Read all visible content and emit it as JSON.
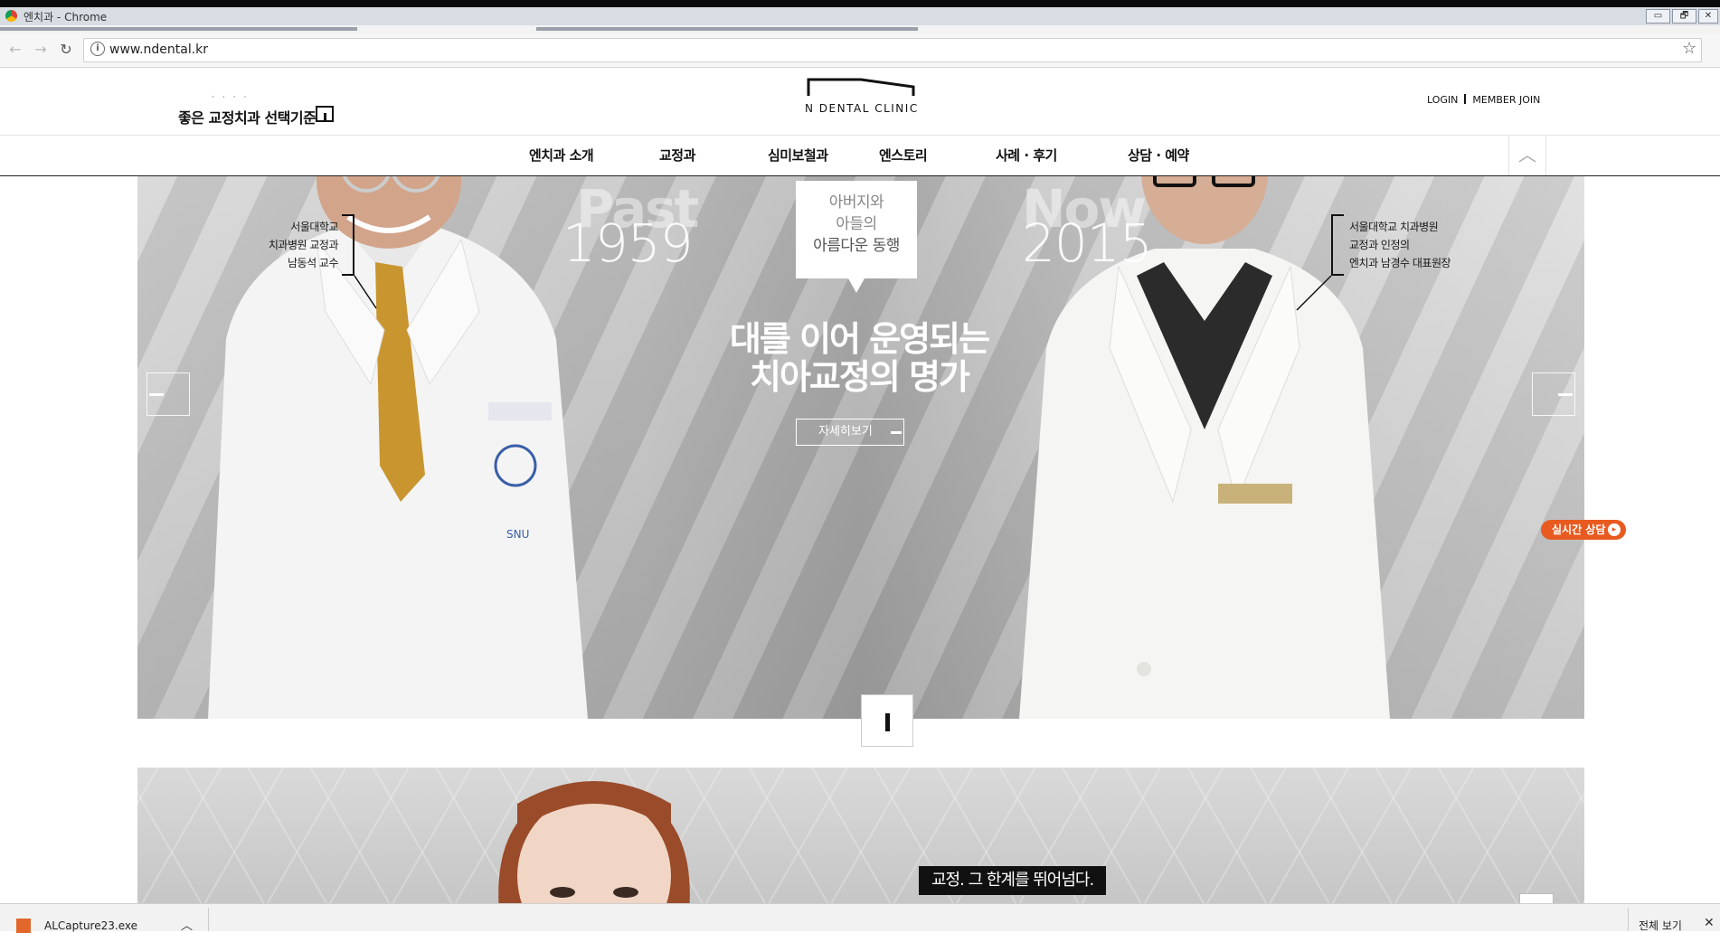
{
  "browser": {
    "window_title": "엔치과 - Chrome",
    "url": "www.ndental.kr",
    "win_buttons": [
      "▭",
      "🗗",
      "✕"
    ]
  },
  "header": {
    "slogan": "좋은 교정치과 선택기준",
    "logo_text": "N DENTAL CLINIC",
    "login": "LOGIN",
    "member_join": "MEMBER JOIN"
  },
  "gnb": {
    "items": [
      "엔치과 소개",
      "교정과",
      "심미보철과",
      "엔스토리",
      "사례 · 후기",
      "상담 · 예약"
    ]
  },
  "hero": {
    "past_word": "Past",
    "past_year": "1959",
    "now_word": "Now",
    "now_year": "2015",
    "left_caption": [
      "서울대학교",
      "치과병원 교정과",
      "남동석 교수"
    ],
    "right_caption": [
      "서울대학교 치과병원",
      "교정과 인정의",
      "엔치과 남경수 대표원장"
    ],
    "quote": [
      "아버지와",
      "아들의",
      "아름다운 동행"
    ],
    "headline": [
      "대를 이어 운영되는",
      "치아교정의 명가"
    ],
    "more_button": "자세히보기",
    "chat_button": "실시간 상담"
  },
  "banner2": {
    "copy": "교정. 그 한계를 뛰어넘다."
  },
  "downloads": {
    "file_name": "ALCapture23.exe",
    "show_all": "전체 보기"
  },
  "colors": {
    "accent": "#e85a1f",
    "nav_border": "#222222"
  }
}
